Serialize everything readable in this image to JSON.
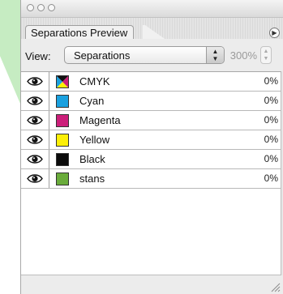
{
  "window": {
    "tab_label": "Separations Preview"
  },
  "toolbar": {
    "view_label": "View:",
    "view_value": "Separations",
    "zoom_value": "300%"
  },
  "separations": [
    {
      "name": "CMYK",
      "percent": "0%",
      "swatch": "cmyk"
    },
    {
      "name": "Cyan",
      "percent": "0%",
      "swatch": "#1aa1e0"
    },
    {
      "name": "Magenta",
      "percent": "0%",
      "swatch": "#cc1f7a"
    },
    {
      "name": "Yellow",
      "percent": "0%",
      "swatch": "#fcef06"
    },
    {
      "name": "Black",
      "percent": "0%",
      "swatch": "#0b0b0b"
    },
    {
      "name": "stans",
      "percent": "0%",
      "swatch": "#6aac3b"
    }
  ],
  "colors": {
    "accent_green_background": "#c6ecc2"
  }
}
